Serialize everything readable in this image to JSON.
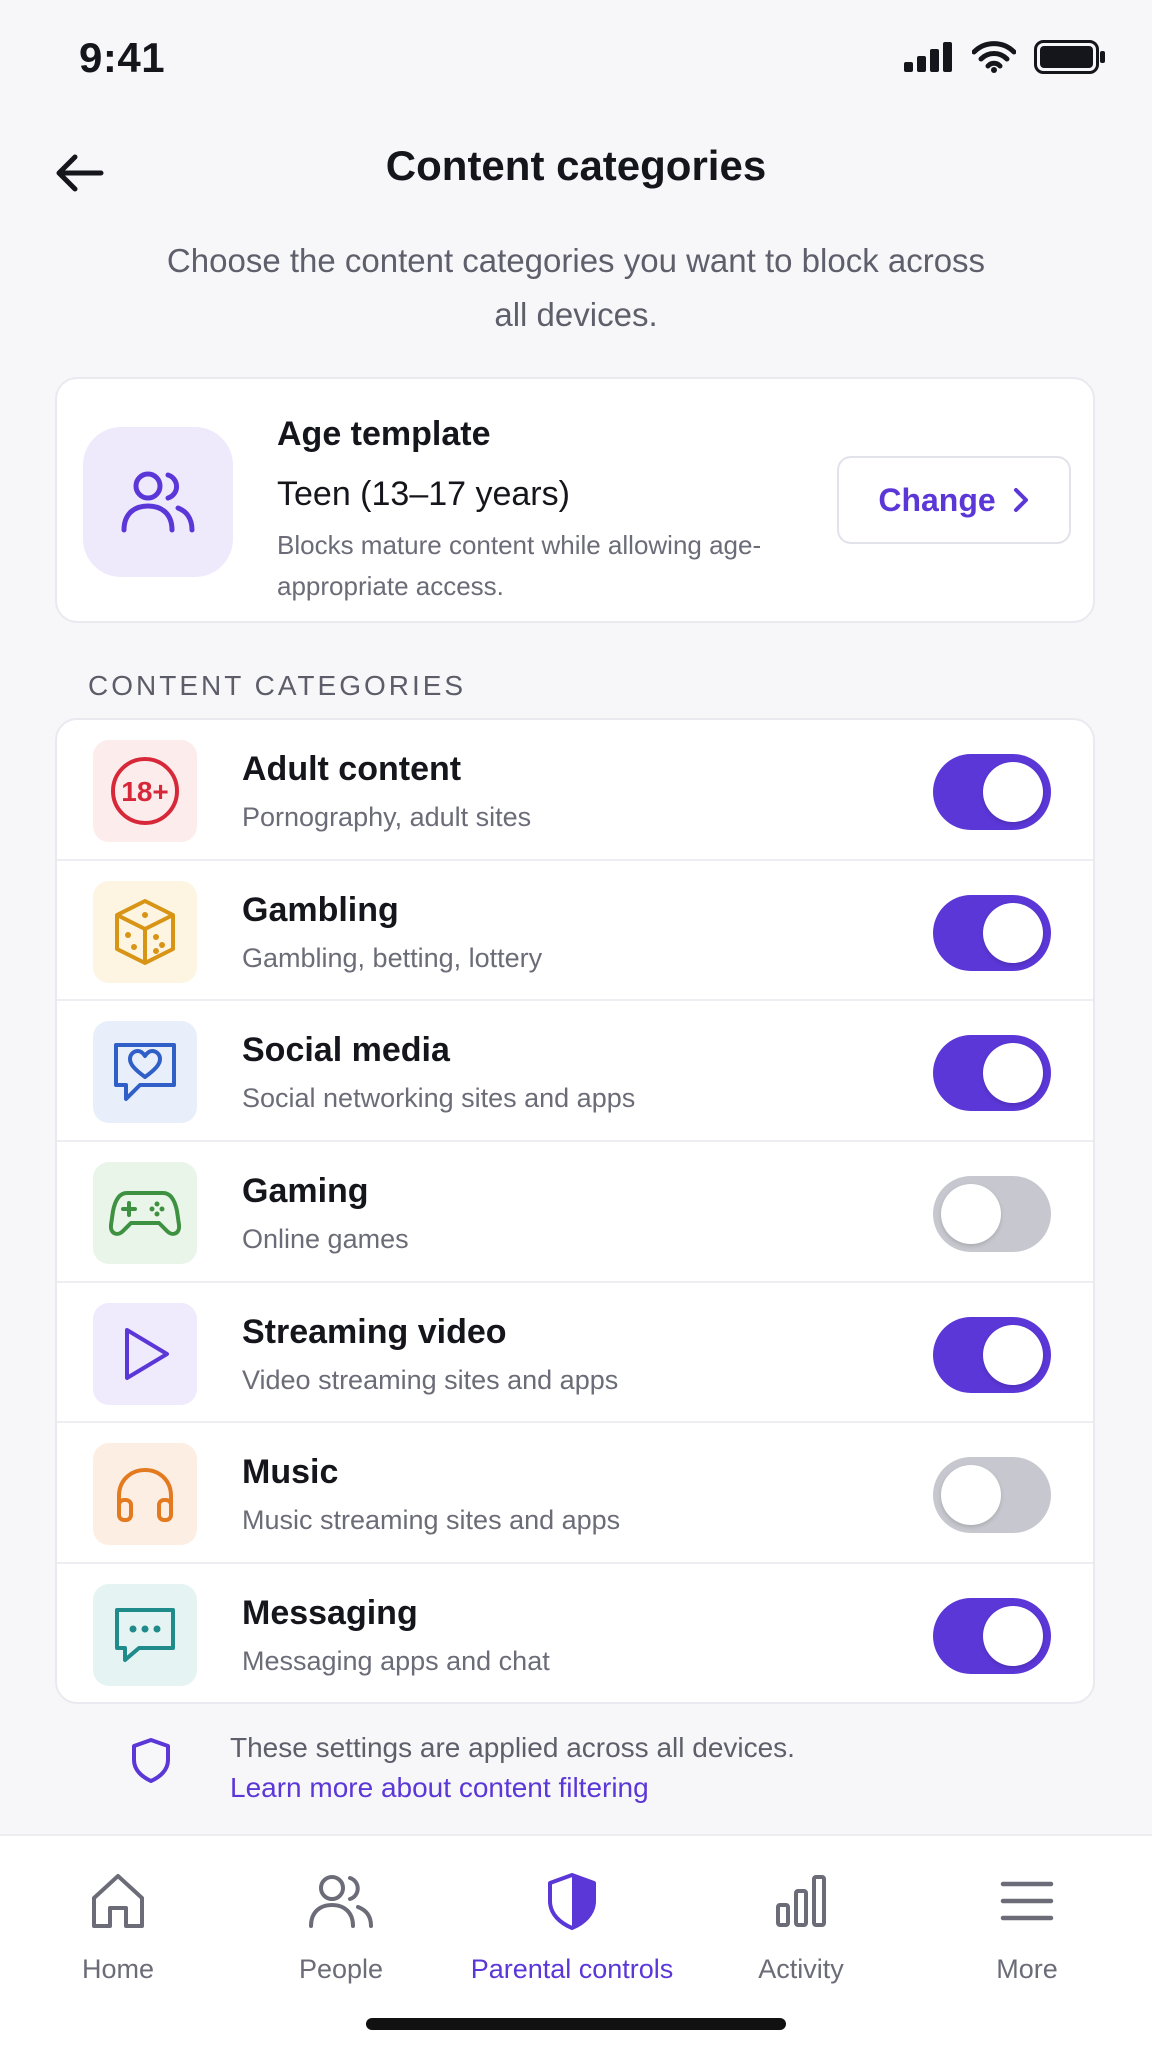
{
  "status_bar": {
    "time": "9:41"
  },
  "header": {
    "title": "Content categories"
  },
  "subtitle": "Choose the content categories you want to block across all devices.",
  "age_template": {
    "heading": "Age template",
    "value": "Teen (13–17 years)",
    "description": "Blocks mature content while allowing age-appropriate access.",
    "change_label": "Change"
  },
  "section_label": "CONTENT CATEGORIES",
  "categories": [
    {
      "title": "Adult content",
      "description": "Pornography, adult sites",
      "enabled": true,
      "icon": "adult-18-icon",
      "icon_color": "#D62839",
      "icon_bg": "#FDECEC",
      "icon_text": "18+"
    },
    {
      "title": "Gambling",
      "description": "Gambling, betting, lottery",
      "enabled": true,
      "icon": "dice-icon",
      "icon_color": "#D89414",
      "icon_bg": "#FEF4E2"
    },
    {
      "title": "Social media",
      "description": "Social networking sites and apps",
      "enabled": true,
      "icon": "chat-heart-icon",
      "icon_color": "#2F5FC7",
      "icon_bg": "#E8EFFB"
    },
    {
      "title": "Gaming",
      "description": "Online games",
      "enabled": false,
      "icon": "gamepad-icon",
      "icon_color": "#3E9141",
      "icon_bg": "#EAF5EA"
    },
    {
      "title": "Streaming video",
      "description": "Video streaming sites and apps",
      "enabled": true,
      "icon": "play-icon",
      "icon_color": "#5B37D8",
      "icon_bg": "#EFEBFC"
    },
    {
      "title": "Music",
      "description": "Music streaming sites and apps",
      "enabled": false,
      "icon": "headphones-icon",
      "icon_color": "#E47A1F",
      "icon_bg": "#FDEEE3"
    },
    {
      "title": "Messaging",
      "description": "Messaging apps and chat",
      "enabled": true,
      "icon": "message-dots-icon",
      "icon_color": "#1F8B8A",
      "icon_bg": "#E5F4F2"
    }
  ],
  "footer": {
    "note": "These settings are applied across all devices.",
    "link": "Learn more about content filtering"
  },
  "bottom_nav": [
    {
      "label": "Home",
      "icon": "home-icon",
      "active": false
    },
    {
      "label": "People",
      "icon": "people-icon",
      "active": false
    },
    {
      "label": "Parental controls",
      "icon": "shield-icon",
      "active": true
    },
    {
      "label": "Activity",
      "icon": "bar-chart-icon",
      "active": false
    },
    {
      "label": "More",
      "icon": "menu-icon",
      "active": false
    }
  ],
  "colors": {
    "accent": "#5B37D8",
    "toggle_off": "#C7C7CF",
    "background": "#F7F7F9"
  }
}
